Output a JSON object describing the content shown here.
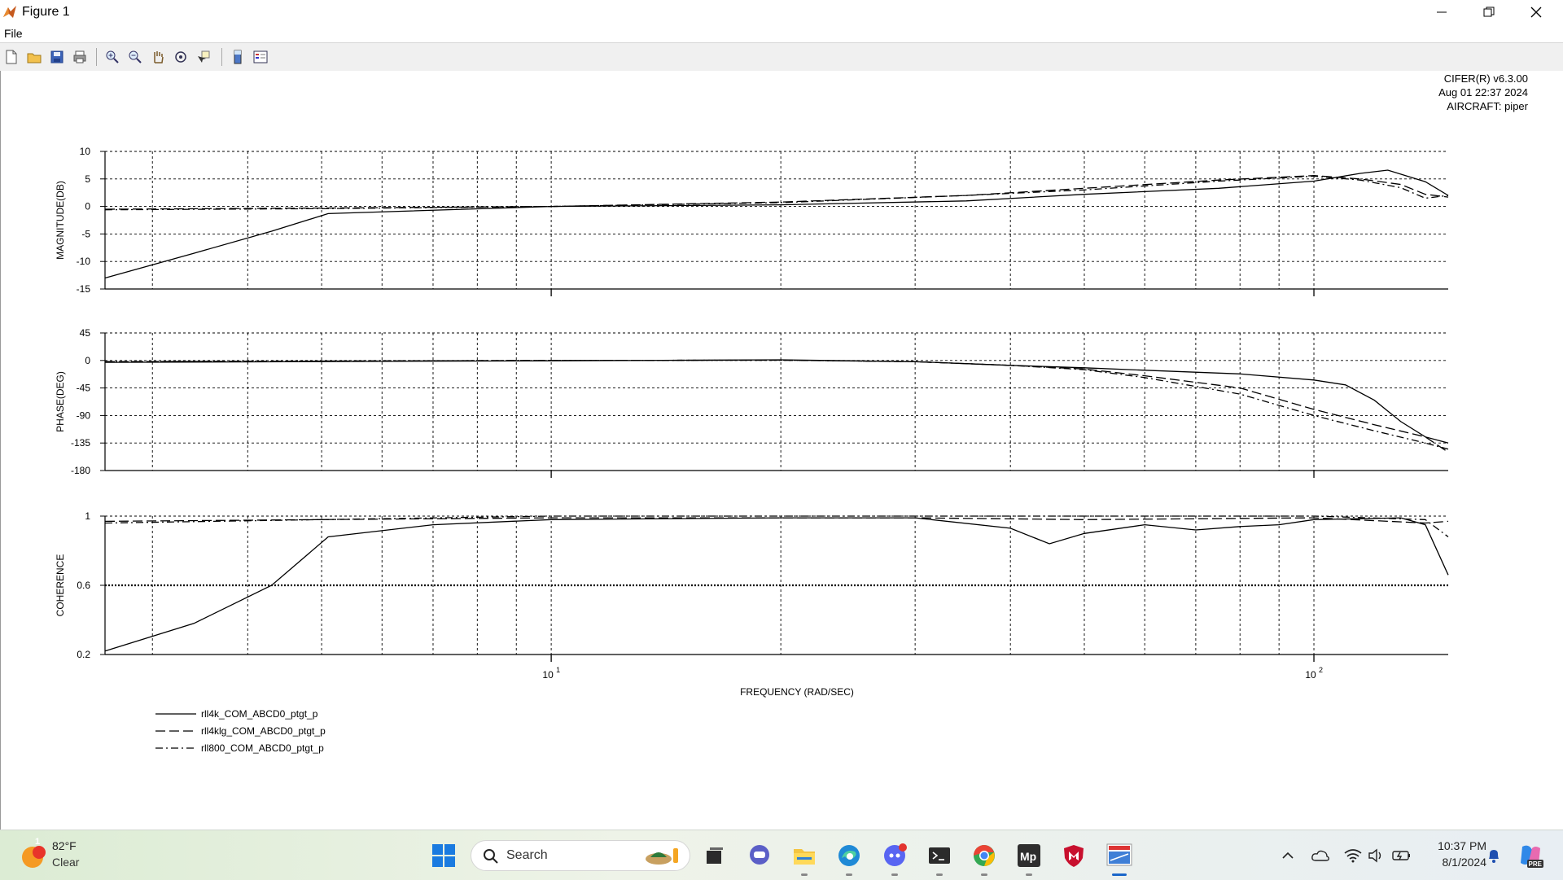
{
  "window": {
    "title": "Figure 1"
  },
  "menu": {
    "file": "File"
  },
  "toolbar": {
    "buttons": [
      "new-figure-icon",
      "open-file-icon",
      "save-icon",
      "print-icon",
      "zoom-in-icon",
      "zoom-out-icon",
      "pan-icon",
      "rotate-3d-icon",
      "data-cursor-icon",
      "insert-colorbar-icon",
      "insert-legend-icon"
    ]
  },
  "info": {
    "line1": "CIFER(R) v6.3.00",
    "line2": "Aug 01 22:37 2024",
    "line3": "AIRCRAFT: piper"
  },
  "chart_data": [
    {
      "type": "line",
      "ylabel": "MAGNITUDE(DB)",
      "xscale": "log",
      "xlim": [
        2.6,
        150
      ],
      "ylim": [
        -15,
        10
      ],
      "yticks": [
        10,
        5,
        0,
        -5,
        -10,
        -15
      ],
      "grid": true,
      "series": [
        {
          "name": "rll4k_COM_ABCD0_ptgt_p",
          "style": "solid",
          "points": [
            [
              2.6,
              -13
            ],
            [
              3.4,
              -8.5
            ],
            [
              4.3,
              -4.5
            ],
            [
              5.1,
              -1.3
            ],
            [
              10,
              0
            ],
            [
              20,
              0.3
            ],
            [
              35,
              1
            ],
            [
              50,
              2.2
            ],
            [
              75,
              3.3
            ],
            [
              100,
              4.6
            ],
            [
              115,
              6
            ],
            [
              125,
              6.6
            ],
            [
              140,
              4.5
            ],
            [
              150,
              2
            ]
          ]
        },
        {
          "name": "rll4klg_COM_ABCD0_ptgt_p",
          "style": "dashed",
          "points": [
            [
              2.6,
              -0.5
            ],
            [
              5,
              -0.3
            ],
            [
              10,
              0
            ],
            [
              20,
              0.8
            ],
            [
              35,
              2
            ],
            [
              50,
              3.3
            ],
            [
              75,
              4.8
            ],
            [
              100,
              5.6
            ],
            [
              115,
              5
            ],
            [
              130,
              4
            ],
            [
              140,
              2.2
            ],
            [
              150,
              1.7
            ]
          ]
        },
        {
          "name": "rll800_COM_ABCD0_ptgt_p",
          "style": "dashdot",
          "points": [
            [
              2.6,
              -0.6
            ],
            [
              5,
              -0.4
            ],
            [
              10,
              0
            ],
            [
              20,
              0.7
            ],
            [
              35,
              2
            ],
            [
              50,
              3
            ],
            [
              75,
              4.6
            ],
            [
              100,
              5.5
            ],
            [
              115,
              4.8
            ],
            [
              130,
              3.4
            ],
            [
              140,
              1.5
            ],
            [
              150,
              2
            ]
          ]
        }
      ]
    },
    {
      "type": "line",
      "ylabel": "PHASE(DEG)",
      "xscale": "log",
      "xlim": [
        2.6,
        150
      ],
      "ylim": [
        -180,
        45
      ],
      "yticks": [
        45,
        0,
        -45,
        -90,
        -135,
        -180
      ],
      "grid": true,
      "series": [
        {
          "name": "rll4k_COM_ABCD0_ptgt_p",
          "style": "solid",
          "points": [
            [
              2.6,
              -3
            ],
            [
              10,
              -0.5
            ],
            [
              20,
              1
            ],
            [
              30,
              -2
            ],
            [
              40,
              -8
            ],
            [
              50,
              -12
            ],
            [
              60,
              -16
            ],
            [
              80,
              -22
            ],
            [
              100,
              -32
            ],
            [
              110,
              -40
            ],
            [
              120,
              -65
            ],
            [
              130,
              -100
            ],
            [
              140,
              -125
            ],
            [
              150,
              -135
            ]
          ]
        },
        {
          "name": "rll4klg_COM_ABCD0_ptgt_p",
          "style": "dashed",
          "points": [
            [
              2.6,
              -2
            ],
            [
              10,
              0
            ],
            [
              20,
              0.5
            ],
            [
              30,
              -2
            ],
            [
              40,
              -8
            ],
            [
              50,
              -14
            ],
            [
              60,
              -25
            ],
            [
              80,
              -45
            ],
            [
              100,
              -80
            ],
            [
              120,
              -105
            ],
            [
              140,
              -125
            ],
            [
              150,
              -150
            ]
          ]
        },
        {
          "name": "rll800_COM_ABCD0_ptgt_p",
          "style": "dashdot",
          "points": [
            [
              2.6,
              -2
            ],
            [
              10,
              0
            ],
            [
              20,
              0.5
            ],
            [
              30,
              -2
            ],
            [
              40,
              -8
            ],
            [
              50,
              -15
            ],
            [
              60,
              -28
            ],
            [
              80,
              -55
            ],
            [
              100,
              -90
            ],
            [
              120,
              -115
            ],
            [
              140,
              -135
            ],
            [
              150,
              -145
            ]
          ]
        }
      ]
    },
    {
      "type": "line",
      "ylabel": "COHERENCE",
      "xscale": "log",
      "xlim": [
        2.6,
        150
      ],
      "ylim": [
        0.2,
        1
      ],
      "yticks": [
        1,
        0.6,
        0.2
      ],
      "grid": true,
      "series": [
        {
          "name": "rll4k_COM_ABCD0_ptgt_p",
          "style": "solid",
          "points": [
            [
              2.6,
              0.22
            ],
            [
              3.4,
              0.38
            ],
            [
              4.3,
              0.6
            ],
            [
              5.1,
              0.88
            ],
            [
              7,
              0.95
            ],
            [
              10,
              0.98
            ],
            [
              20,
              0.99
            ],
            [
              30,
              0.99
            ],
            [
              40,
              0.93
            ],
            [
              45,
              0.84
            ],
            [
              50,
              0.9
            ],
            [
              60,
              0.95
            ],
            [
              70,
              0.92
            ],
            [
              80,
              0.94
            ],
            [
              90,
              0.95
            ],
            [
              100,
              0.98
            ],
            [
              130,
              0.99
            ],
            [
              140,
              0.95
            ],
            [
              150,
              0.66
            ]
          ]
        },
        {
          "name": "rll4klg_COM_ABCD0_ptgt_p",
          "style": "dashed",
          "points": [
            [
              2.6,
              0.97
            ],
            [
              5,
              0.98
            ],
            [
              10,
              0.99
            ],
            [
              30,
              0.99
            ],
            [
              50,
              0.98
            ],
            [
              100,
              0.99
            ],
            [
              140,
              0.96
            ],
            [
              150,
              0.97
            ]
          ]
        },
        {
          "name": "rll800_COM_ABCD0_ptgt_p",
          "style": "dashdot",
          "points": [
            [
              2.6,
              0.96
            ],
            [
              5,
              0.98
            ],
            [
              10,
              1
            ],
            [
              30,
              1
            ],
            [
              60,
              1
            ],
            [
              100,
              1
            ],
            [
              140,
              0.98
            ],
            [
              150,
              0.88
            ]
          ]
        }
      ]
    }
  ],
  "xaxis": {
    "label": "FREQUENCY (RAD/SEC)",
    "ticks": [
      {
        "value": 10,
        "base": "10",
        "exp": "1"
      },
      {
        "value": 100,
        "base": "10",
        "exp": "2"
      }
    ]
  },
  "legend": [
    "rll4k_COM_ABCD0_ptgt_p",
    "rll4klg_COM_ABCD0_ptgt_p",
    "rll800_COM_ABCD0_ptgt_p"
  ],
  "taskbar": {
    "weather": {
      "temp": "82°F",
      "condition": "Clear",
      "badge": "1"
    },
    "search": "Search",
    "clock": {
      "time": "10:37 PM",
      "date": "8/1/2024"
    }
  }
}
